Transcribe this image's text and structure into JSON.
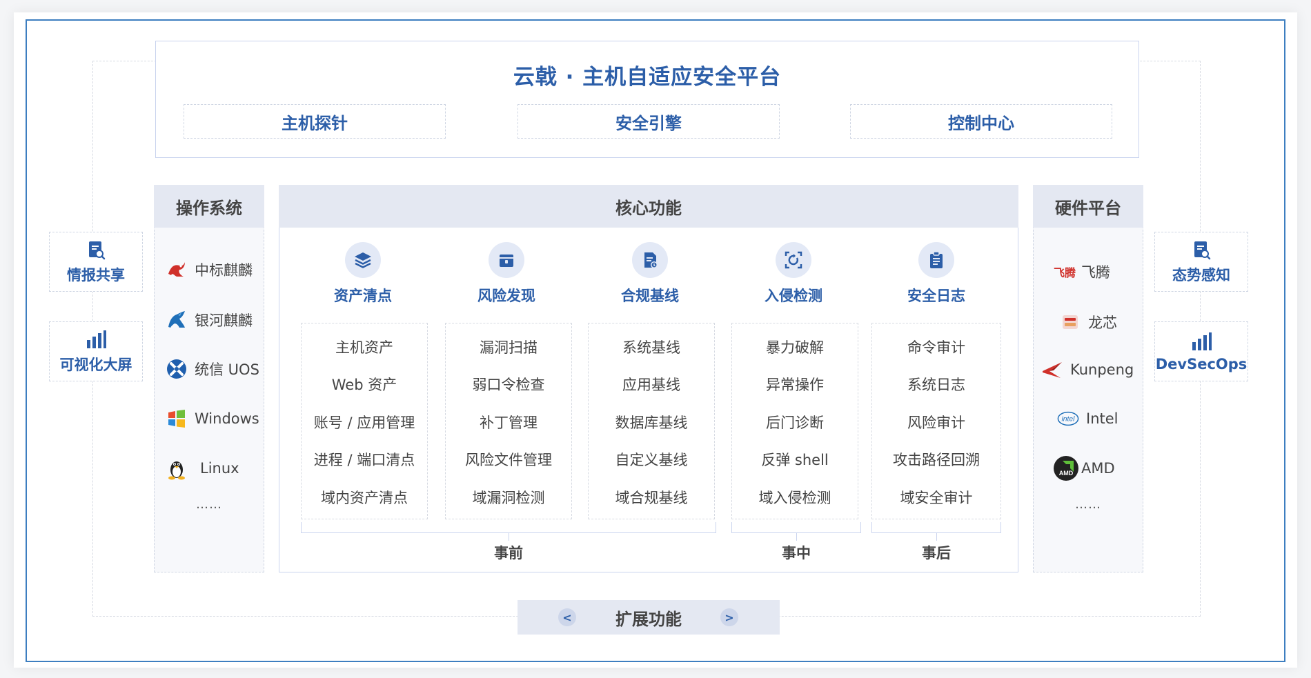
{
  "platform": {
    "title": "云戟 · 主机自适应安全平台",
    "modules": [
      "主机探针",
      "安全引擎",
      "控制中心"
    ]
  },
  "os": {
    "title": "操作系统",
    "items": [
      "中标麒麟",
      "银河麒麟",
      "统信 UOS",
      "Windows",
      "Linux"
    ],
    "more": "……"
  },
  "core": {
    "title": "核心功能",
    "categories": [
      {
        "label": "资产清点",
        "items": [
          "主机资产",
          "Web 资产",
          "账号 / 应用管理",
          "进程 / 端口清点",
          "域内资产清点"
        ]
      },
      {
        "label": "风险发现",
        "items": [
          "漏洞扫描",
          "弱口令检查",
          "补丁管理",
          "风险文件管理",
          "域漏洞检测"
        ]
      },
      {
        "label": "合规基线",
        "items": [
          "系统基线",
          "应用基线",
          "数据库基线",
          "自定义基线",
          "域合规基线"
        ]
      },
      {
        "label": "入侵检测",
        "items": [
          "暴力破解",
          "异常操作",
          "后门诊断",
          "反弹 shell",
          "域入侵检测"
        ]
      },
      {
        "label": "安全日志",
        "items": [
          "命令审计",
          "系统日志",
          "风险审计",
          "攻击路径回溯",
          "域安全审计"
        ]
      }
    ],
    "phases": [
      "事前",
      "事中",
      "事后"
    ]
  },
  "hardware": {
    "title": "硬件平台",
    "items": [
      "飞腾",
      "龙芯",
      "Kunpeng",
      "Intel",
      "AMD"
    ],
    "more": "……",
    "logo_text": {
      "feiteng": "飞腾",
      "intel": "intel",
      "amd": "AMD"
    }
  },
  "left_ext": [
    "情报共享",
    "可视化大屏"
  ],
  "right_ext": [
    "态势感知",
    "DevSecOps"
  ],
  "extension": {
    "label": "扩展功能",
    "prev": "<",
    "next": ">"
  },
  "colors": {
    "primary": "#2c5ea8",
    "frame": "#3d7ec0",
    "header_bg": "#e4e8f2",
    "icon_bg": "#e3e9f6"
  }
}
